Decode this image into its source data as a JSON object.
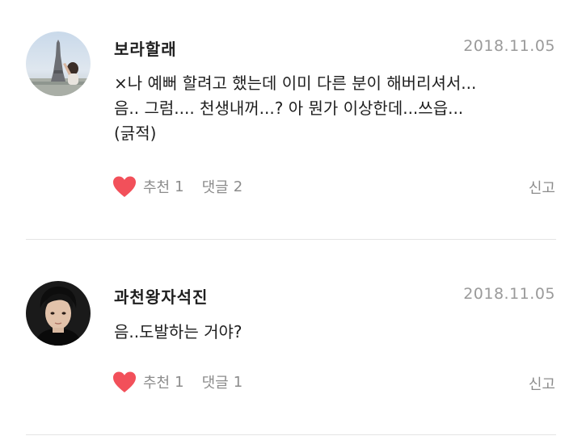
{
  "comments": [
    {
      "username": "보라할래",
      "date": "2018.11.05",
      "body_lines": [
        "×나 예뻐 할려고 했는데 이미 다른 분이 해버리셔서...",
        "음.. 그럼.... 천생내꺼...? 아 뭔가 이상한데...쓰읍...",
        "(긁적)"
      ],
      "like_label": "추천",
      "like_count": "1",
      "reply_label": "댓글",
      "reply_count": "2",
      "report_label": "신고",
      "avatar_icon": "profile-photo-eiffel-tower"
    },
    {
      "username": "과천왕자석진",
      "date": "2018.11.05",
      "body_lines": [
        "음..도발하는 거야?"
      ],
      "like_label": "추천",
      "like_count": "1",
      "reply_label": "댓글",
      "reply_count": "1",
      "report_label": "신고",
      "avatar_icon": "profile-photo-portrait"
    }
  ],
  "colors": {
    "heart": "#f2505a",
    "muted_text": "#8c8c8c",
    "date_text": "#9a9a9a",
    "divider": "#e4e4e4"
  }
}
